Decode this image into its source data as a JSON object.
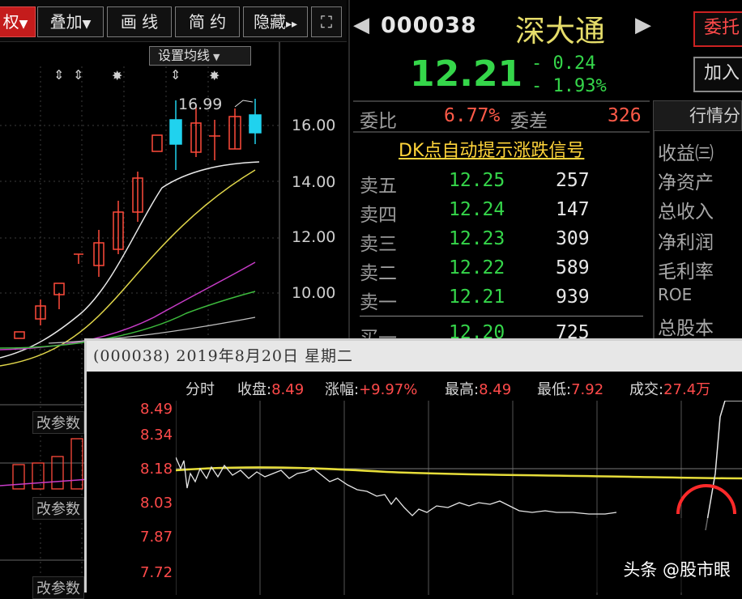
{
  "toolbar": {
    "buttons": [
      {
        "label": "权",
        "arrow": "▼"
      },
      {
        "label": "叠加",
        "arrow": "▼"
      },
      {
        "label": "画 线"
      },
      {
        "label": "简 约"
      },
      {
        "label": "隐藏",
        "arrow": "▸▸"
      },
      {
        "label": "⛶"
      }
    ]
  },
  "kline": {
    "set_ma_label": "设置均线",
    "high_label": "16.99",
    "yaxis": [
      "16.00",
      "14.00",
      "12.00",
      "10.00"
    ],
    "gaican": [
      "改参数",
      "改参数",
      "改参数"
    ]
  },
  "quote": {
    "code": "000038",
    "name": "深大通",
    "price": "12.21",
    "change": "- 0.24",
    "change_pct": "- 1.93%",
    "order_button": "委托",
    "add_button": "加入",
    "weibi_label": "委比",
    "weibi_value": "6.77%",
    "weicha_label": "委差",
    "weicha_value": "326",
    "dk_signal": "DK点自动提示涨跌信号",
    "asks": [
      {
        "label": "卖五",
        "price": "12.25",
        "vol": "257"
      },
      {
        "label": "卖四",
        "price": "12.24",
        "vol": "147"
      },
      {
        "label": "卖三",
        "price": "12.23",
        "vol": "309"
      },
      {
        "label": "卖二",
        "price": "12.22",
        "vol": "589"
      },
      {
        "label": "卖一",
        "price": "12.21",
        "vol": "939"
      }
    ],
    "bid_partial": {
      "label": "买一",
      "price": "12.20",
      "vol": "725"
    }
  },
  "fin": {
    "tab": "行情分",
    "items": [
      "收益㈢",
      "净资产",
      "总收入",
      "净利润",
      "毛利率",
      "ROE",
      "总股本"
    ]
  },
  "popup": {
    "title": "(000038) 2019年8月20日 星期二",
    "tab": "分时",
    "stats": [
      {
        "k": "收盘:",
        "v": "8.49"
      },
      {
        "k": "涨幅:",
        "v": "+9.97%"
      },
      {
        "k": "最高:",
        "v": "8.49"
      },
      {
        "k": "最低:",
        "v": "7.92"
      },
      {
        "k": "成交:",
        "v": "27.4万"
      }
    ],
    "yaxis": [
      "8.49",
      "8.34",
      "8.18",
      "8.03",
      "7.87",
      "7.72"
    ]
  },
  "watermark": "头条 @股市眼",
  "colors": {
    "up": "#ff4a4a",
    "down": "#35d64a",
    "avg": "#e6dd3a"
  }
}
